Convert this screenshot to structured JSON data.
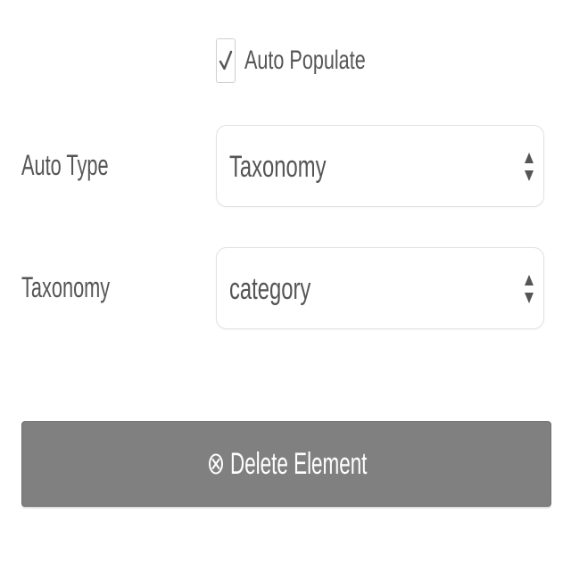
{
  "auto_populate": {
    "label": "Auto Populate",
    "checked": true,
    "icon": "checkmark-icon"
  },
  "auto_type": {
    "label": "Auto Type",
    "selected": "Taxonomy",
    "icon": "select-arrows-icon"
  },
  "taxonomy": {
    "label": "Taxonomy",
    "selected": "category",
    "icon": "select-arrows-icon"
  },
  "delete_button": {
    "label": "Delete Element",
    "icon": "circle-x-icon",
    "background": "#808080",
    "text_color": "#ffffff"
  }
}
